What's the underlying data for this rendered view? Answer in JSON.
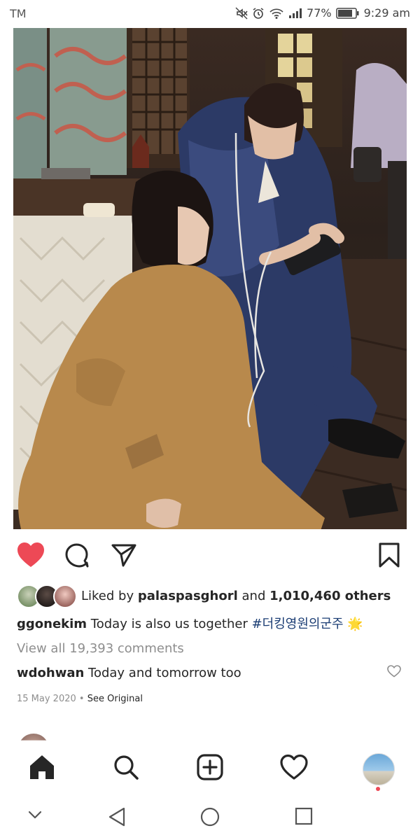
{
  "status_bar": {
    "carrier": "TM",
    "battery": "77%",
    "time": "9:29 am",
    "icons": [
      "mute-icon",
      "alarm-icon",
      "wifi-icon",
      "signal-icon",
      "battery-icon"
    ]
  },
  "post": {
    "photo_alt": "",
    "actions": [
      "heart-filled-icon",
      "comment-icon",
      "share-icon",
      "bookmark-icon"
    ],
    "likes": {
      "prefix": "Liked by",
      "user": "palaspasghorl",
      "middle": "and",
      "count": "1,010,460 others"
    },
    "caption": {
      "user": "ggonekim",
      "text": "Today is also us together",
      "hashtag": "#더킹영원의군주",
      "emoji": "🌟"
    },
    "view_all": "View all 19,393 comments",
    "comment": {
      "user": "wdohwan",
      "text": "Today and tomorrow too"
    },
    "date": "15 May 2020",
    "separator": "•",
    "see_original": "See Original"
  },
  "bottom_nav": {
    "items": [
      "home-icon",
      "search-icon",
      "new-post-icon",
      "activity-icon",
      "profile-avatar"
    ]
  },
  "system_nav": {
    "items": [
      "collapse-icon",
      "back-icon",
      "home-circle-icon",
      "recents-icon"
    ]
  },
  "colors": {
    "like_red": "#ed4956",
    "hashtag_blue": "#1a3c73",
    "muted_gray": "#8e8e8e"
  }
}
